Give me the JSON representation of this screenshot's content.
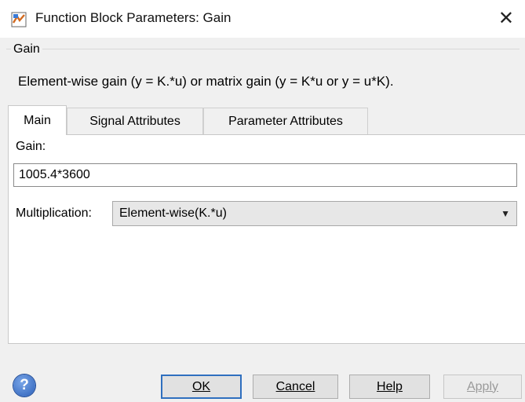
{
  "window": {
    "title": "Function Block Parameters: Gain",
    "close_glyph": "✕",
    "icon": "simulink-block-icon"
  },
  "group": {
    "label": "Gain",
    "description": "Element-wise gain (y = K.*u) or matrix gain (y = K*u or y = u*K)."
  },
  "tabs": [
    {
      "label": "Main",
      "active": true
    },
    {
      "label": "Signal Attributes",
      "active": false
    },
    {
      "label": "Parameter Attributes",
      "active": false
    }
  ],
  "main": {
    "gain_label": "Gain:",
    "gain_value": "1005.4*3600",
    "multiplication_label": "Multiplication:",
    "multiplication_value": "Element-wise(K.*u)"
  },
  "buttons": {
    "help_icon": "question-mark-icon",
    "ok": "OK",
    "cancel": "Cancel",
    "help": "Help",
    "apply": "Apply"
  },
  "colors": {
    "default_button_border": "#2f6fbf",
    "help_icon": "#2b5fb8"
  }
}
